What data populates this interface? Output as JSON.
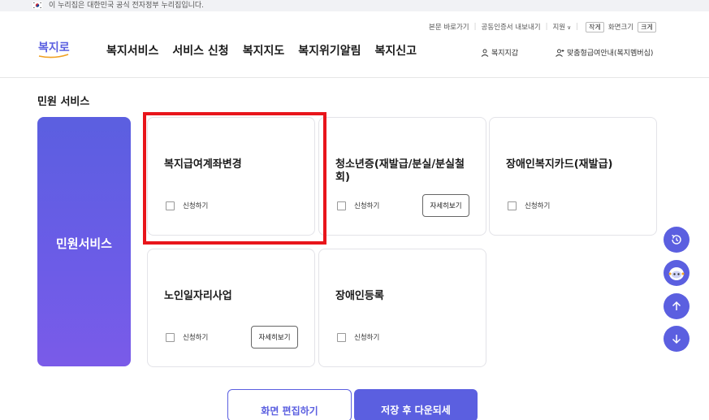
{
  "gov_banner": {
    "text": "이 누리집은 대한민국 공식 전자정부 누리집입니다."
  },
  "utility": {
    "skip": "본문 바로가기",
    "cert": "공동인증서 내보내기",
    "support": "지원",
    "size_label": "화면크기",
    "small": "작게",
    "large": "크게"
  },
  "logo": {
    "text": "복지로"
  },
  "nav": {
    "items": [
      "복지서비스",
      "서비스 신청",
      "복지지도",
      "복지위기알림",
      "복지신고"
    ],
    "wallet": "복지지갑",
    "membership": "맞춤형급여안내(복지멤버십)"
  },
  "section": {
    "title": "민원 서비스"
  },
  "side": {
    "label": "민원서비스"
  },
  "cards": [
    {
      "title": "복지급여계좌변경",
      "apply": "신청하기"
    },
    {
      "title": "청소년증(재발급/분실/분실철회)",
      "apply": "신청하기",
      "detail": "자세히보기"
    },
    {
      "title": "장애인복지카드(재발급)",
      "apply": "신청하기"
    },
    {
      "title": "노인일자리사업",
      "apply": "신청하기",
      "detail": "자세히보기"
    },
    {
      "title": "장애인등록",
      "apply": "신청하기"
    }
  ],
  "bottom": {
    "left": "화면 편집하기",
    "right": "저장 후 다운되세"
  },
  "colors": {
    "accent": "#5b5fe0",
    "highlight": "#e8151b"
  }
}
